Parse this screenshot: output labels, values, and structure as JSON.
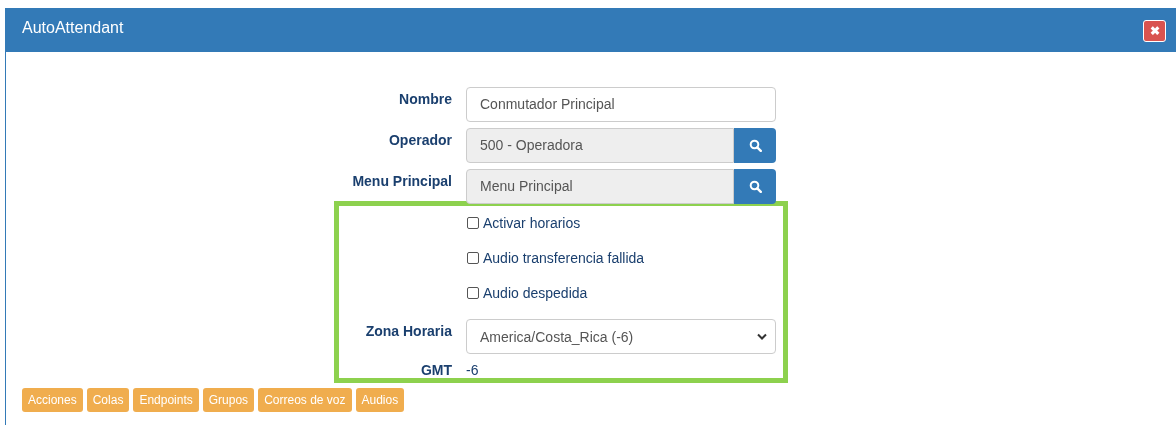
{
  "window": {
    "title": "AutoAttendant",
    "close": "✖"
  },
  "fields": [
    {
      "kind": "text",
      "label": "Nombre",
      "value": "Conmutador Principal"
    },
    {
      "kind": "lookup",
      "label": "Operador",
      "value": "500 - Operadora"
    },
    {
      "kind": "lookup",
      "label": "Menu Principal",
      "value": "Menu Principal"
    }
  ],
  "options": [
    {
      "label": "Activar horarios",
      "checked": false
    },
    {
      "label": "Audio transferencia fallida",
      "checked": false
    },
    {
      "label": "Audio despedida",
      "checked": false
    }
  ],
  "timezone": {
    "label": "Zona Horaria",
    "value": "America/Costa_Rica (-6)"
  },
  "gmt": {
    "label": "GMT",
    "value": "-6"
  },
  "tabs": [
    "Acciones",
    "Colas",
    "Endpoints",
    "Grupos",
    "Correos de voz",
    "Audios"
  ]
}
